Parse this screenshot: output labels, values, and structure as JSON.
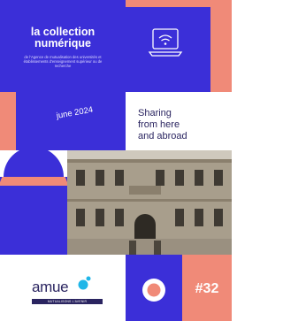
{
  "cover": {
    "title_line1": "la collection",
    "title_line2": "numérique",
    "subtitle": "de l'Agence de mutualisation des universités et établissements d'enseignement supérieur ou de recherche",
    "date": "june 2024",
    "tagline_lines": [
      "Sharing",
      "from here",
      "and abroad"
    ],
    "logo_name": "amue",
    "logo_tagline": "MUTUALISONS L'AVENIR",
    "issue_number": "#32"
  },
  "colors": {
    "blue": "#3b2fd8",
    "salmon": "#f08a78",
    "navy": "#2a2460",
    "white": "#ffffff"
  },
  "icons": {
    "tile_icon": "laptop-wifi-icon"
  }
}
